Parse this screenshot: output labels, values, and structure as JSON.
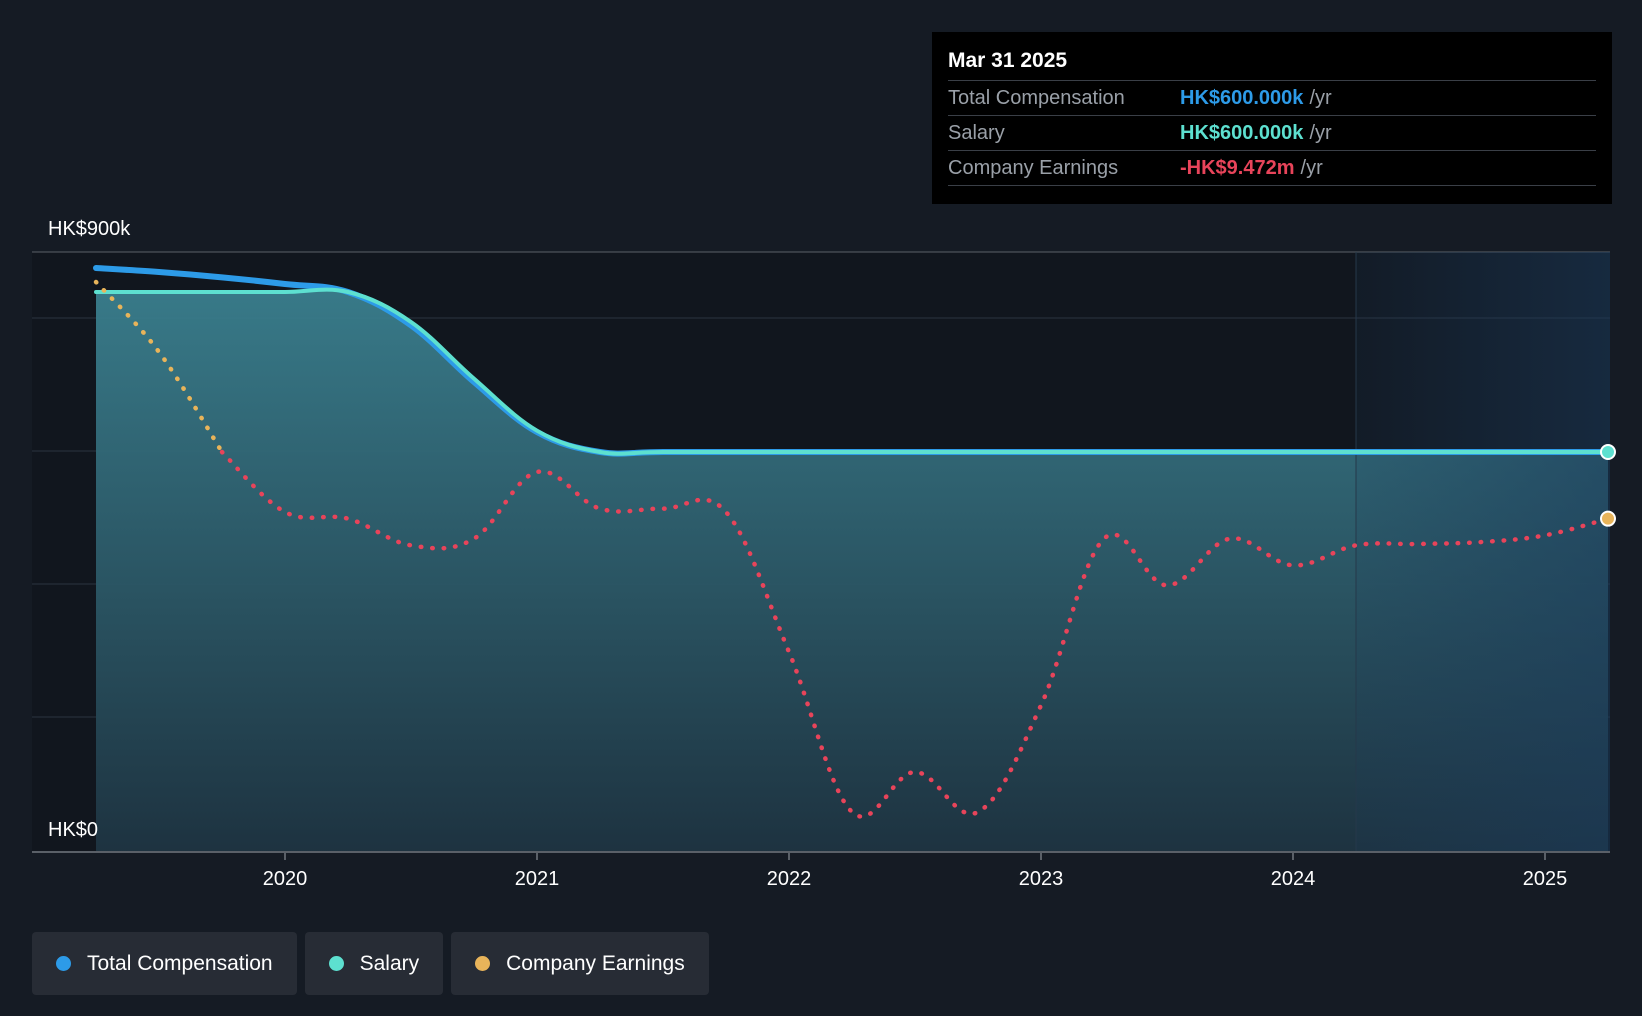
{
  "chart_data": {
    "type": "line",
    "y_axis": {
      "top_label": "HK$900k",
      "bottom_label": "HK$0",
      "ylim": [
        0,
        900
      ]
    },
    "x_axis": {
      "ticks": [
        "2020",
        "2021",
        "2022",
        "2023",
        "2024",
        "2025"
      ],
      "range": [
        2019.25,
        2025.25
      ]
    },
    "forecast_shade_start": 2024.25,
    "series": [
      {
        "name": "Total Compensation",
        "color": "#2d9be8",
        "x": [
          2019.25,
          2019.5,
          2019.75,
          2020.0,
          2020.25,
          2020.5,
          2020.75,
          2021.0,
          2021.25,
          2021.5,
          2022.0,
          2023.0,
          2024.0,
          2025.25
        ],
        "y": [
          876,
          870,
          862,
          852,
          840,
          790,
          705,
          630,
          600,
          600,
          600,
          600,
          600,
          600
        ]
      },
      {
        "name": "Salary",
        "color": "#5de0d0",
        "x": [
          2019.25,
          2019.5,
          2019.75,
          2020.0,
          2020.25,
          2020.5,
          2020.75,
          2021.0,
          2021.25,
          2021.5,
          2022.0,
          2023.0,
          2024.0,
          2025.25
        ],
        "y": [
          840,
          840,
          840,
          840,
          840,
          795,
          710,
          632,
          600,
          600,
          600,
          600,
          600,
          600
        ]
      },
      {
        "name": "Company Earnings",
        "color": "#e8445a",
        "positive_color": "#e8b45a",
        "x": [
          2019.25,
          2019.5,
          2019.75,
          2020.0,
          2020.25,
          2020.5,
          2020.75,
          2021.0,
          2021.25,
          2021.5,
          2021.75,
          2022.0,
          2022.25,
          2022.5,
          2022.75,
          2023.0,
          2023.25,
          2023.5,
          2023.75,
          2024.0,
          2024.25,
          2024.5,
          2024.75,
          2025.0,
          2025.25
        ],
        "y": [
          855,
          750,
          600,
          510,
          500,
          460,
          470,
          570,
          515,
          515,
          510,
          300,
          60,
          120,
          60,
          220,
          470,
          400,
          470,
          430,
          460,
          462,
          465,
          475,
          500
        ]
      }
    ]
  },
  "tooltip": {
    "date": "Mar 31 2025",
    "rows": [
      {
        "label": "Total Compensation",
        "value": "HK$600.000k",
        "unit": "/yr",
        "color": "#2d9be8"
      },
      {
        "label": "Salary",
        "value": "HK$600.000k",
        "unit": "/yr",
        "color": "#5de0d0"
      },
      {
        "label": "Company Earnings",
        "value": "-HK$9.472m",
        "unit": "/yr",
        "color": "#e8445a"
      }
    ]
  },
  "legend": [
    {
      "label": "Total Compensation",
      "color": "#2d9be8"
    },
    {
      "label": "Salary",
      "color": "#5de0d0"
    },
    {
      "label": "Company Earnings",
      "color": "#e8b45a"
    }
  ]
}
